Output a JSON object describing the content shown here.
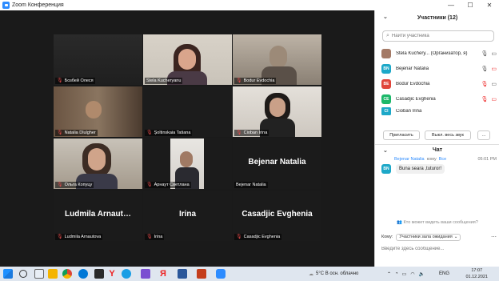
{
  "window": {
    "title": "Zoom Конференция",
    "controls": [
      "—",
      "☐",
      "✕"
    ]
  },
  "video_tiles": [
    {
      "name": "Бозбей Олеся",
      "big_name": "",
      "muted": true
    },
    {
      "name": "Stela Kucheryanu",
      "big_name": "",
      "muted": false,
      "active": true
    },
    {
      "name": "Bodur Evdochia",
      "big_name": "",
      "muted": true
    },
    {
      "name": "Natalia Dlulgher",
      "big_name": "",
      "muted": true
    },
    {
      "name": "Șoltinskaia Tatiana",
      "big_name": "",
      "muted": true
    },
    {
      "name": "Cioban Irina",
      "big_name": "",
      "muted": true
    },
    {
      "name": "Ольга Копуцу",
      "big_name": "",
      "muted": true
    },
    {
      "name": "Арнаут Светлана",
      "big_name": "",
      "muted": true
    },
    {
      "name": "Bejenar Natalia",
      "big_name": "Bejenar Natalia",
      "muted": false
    },
    {
      "name": "Ludmila Arnautova",
      "big_name": "Ludmila  Arnaut…",
      "muted": true
    },
    {
      "name": "Irina",
      "big_name": "Irina",
      "muted": true
    },
    {
      "name": "Casadjic Evghenia",
      "big_name": "Casadjic Evghenia",
      "muted": true
    }
  ],
  "participants": {
    "header": "Участники (12)",
    "search_placeholder": "Найти участника",
    "list": [
      {
        "name": "Stela  Kuchery... (Организатор, я)",
        "initials": "",
        "color": "#b0806a",
        "photo": true
      },
      {
        "name": "Bejenar Natalia",
        "initials": "BN",
        "color": "#1da8c8"
      },
      {
        "name": "Bodur Evdochia",
        "initials": "BE",
        "color": "#e0453a"
      },
      {
        "name": "Casadjic Evghenia",
        "initials": "CE",
        "color": "#1db86a"
      },
      {
        "name": "Cioban Irina",
        "initials": "CI",
        "color": "#1da8c8"
      }
    ],
    "buttons": {
      "invite": "Пригласить",
      "mute_all": "Выкл. весь звук",
      "more": "..."
    }
  },
  "chat": {
    "header": "Чат",
    "message": {
      "sender": "Bejenar Natalia",
      "kom": "кому",
      "to": "Все",
      "time": "05:01 PM",
      "initials": "BN",
      "text": "Buna seara ,tuturor!"
    },
    "who_sees": "Кто может видеть ваши сообщения?",
    "to_label": "Кому:",
    "to_value": "Участники зала ожидания",
    "input_placeholder": "Введите здесь сообщение..."
  },
  "taskbar": {
    "weather": "5°C  В осн. облачно",
    "lang": "ENG",
    "time": "17:07",
    "date": "01.12.2021"
  }
}
